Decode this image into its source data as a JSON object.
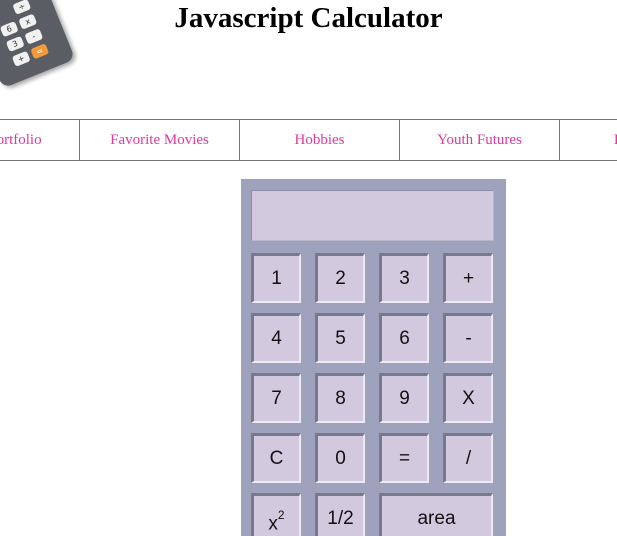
{
  "header": {
    "title": "Javascript Calculator",
    "logo_icon": "calculator-icon",
    "logo_keys": [
      "÷",
      "6",
      "x",
      "3",
      "-",
      "+",
      "="
    ]
  },
  "nav": {
    "items": [
      {
        "label": "Web Portfolio"
      },
      {
        "label": "Favorite Movies"
      },
      {
        "label": "Hobbies"
      },
      {
        "label": "Youth Futures"
      },
      {
        "label": "Pet Care"
      }
    ],
    "link_color": "#e0389e"
  },
  "calculator": {
    "display_value": "",
    "colors": {
      "body": "#9ea2bd",
      "key": "#d3c9de"
    },
    "keys": [
      {
        "label": "1"
      },
      {
        "label": "2"
      },
      {
        "label": "3"
      },
      {
        "label": "+"
      },
      {
        "label": "4"
      },
      {
        "label": "5"
      },
      {
        "label": "6"
      },
      {
        "label": "-"
      },
      {
        "label": "7"
      },
      {
        "label": "8"
      },
      {
        "label": "9"
      },
      {
        "label": "X"
      },
      {
        "label": "C"
      },
      {
        "label": "0"
      },
      {
        "label": "="
      },
      {
        "label": "/"
      },
      {
        "label_base": "x",
        "label_sup": "2"
      },
      {
        "label": "1/2"
      },
      {
        "label": "area"
      }
    ]
  }
}
